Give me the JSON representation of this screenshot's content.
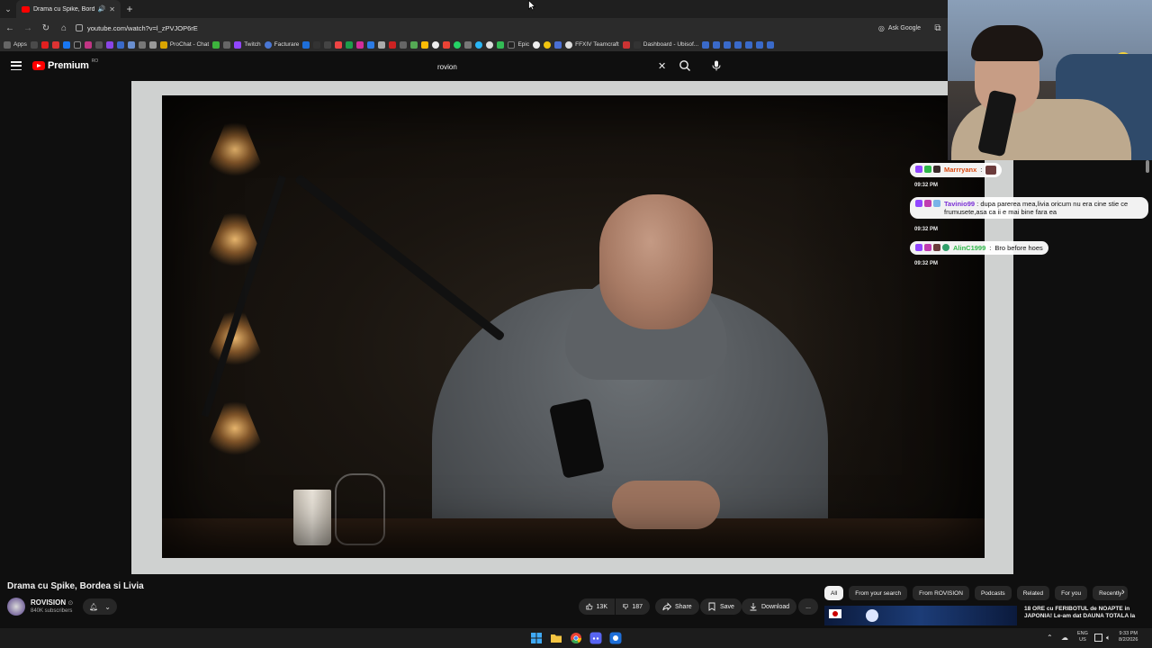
{
  "browser": {
    "tab_title": "Drama cu Spike, Bordea si L",
    "url_host": "youtube.com/watch?v=l_zPVJOP6rE",
    "ask_google": "Ask Google",
    "bookmarks": [
      "Apps",
      "ProChat - Chat",
      "Twitch",
      "Facturare",
      "Epic",
      "FFXIV Teamcraft",
      "Dashboard - Ubisof..."
    ]
  },
  "youtube": {
    "logo_text": "Premium",
    "logo_region": "RO",
    "search_value": "rovion"
  },
  "chat": {
    "messages": [
      {
        "user": "Marrryanx",
        "text": "",
        "time": "09:32 PM",
        "user_color": "#d9480f"
      },
      {
        "user": "Tavinio99",
        "text": "dupa parerea mea,livia oricum nu era cine stie ce frumusete,asa ca ii e mai bine fara ea",
        "time": "09:32 PM",
        "user_color": "#7b2fd6"
      },
      {
        "user": "AlinC1999",
        "text": "Bro before hoes",
        "time": "09:32 PM",
        "user_color": "#2fb84a"
      }
    ]
  },
  "video": {
    "title": "Drama cu Spike, Bordea si Livia",
    "channel": "ROVISION",
    "verified": "⊙",
    "subscribers": "840K subscribers"
  },
  "actions": {
    "likes": "13K",
    "dislikes": "187",
    "share": "Share",
    "save": "Save",
    "download": "Download",
    "more": "..."
  },
  "chips": [
    "All",
    "From your search",
    "From ROVISION",
    "Podcasts",
    "Related",
    "For you",
    "Recently"
  ],
  "recommendation": {
    "title": "18 ORE cu FERIBOTUL de NOAPTE in JAPONIA! Le-am dat DAUNA TOTALA la"
  },
  "taskbar": {
    "lang_top": "ENG",
    "lang_bottom": "US",
    "time": "9:33 PM",
    "date": "8/2/2026"
  }
}
